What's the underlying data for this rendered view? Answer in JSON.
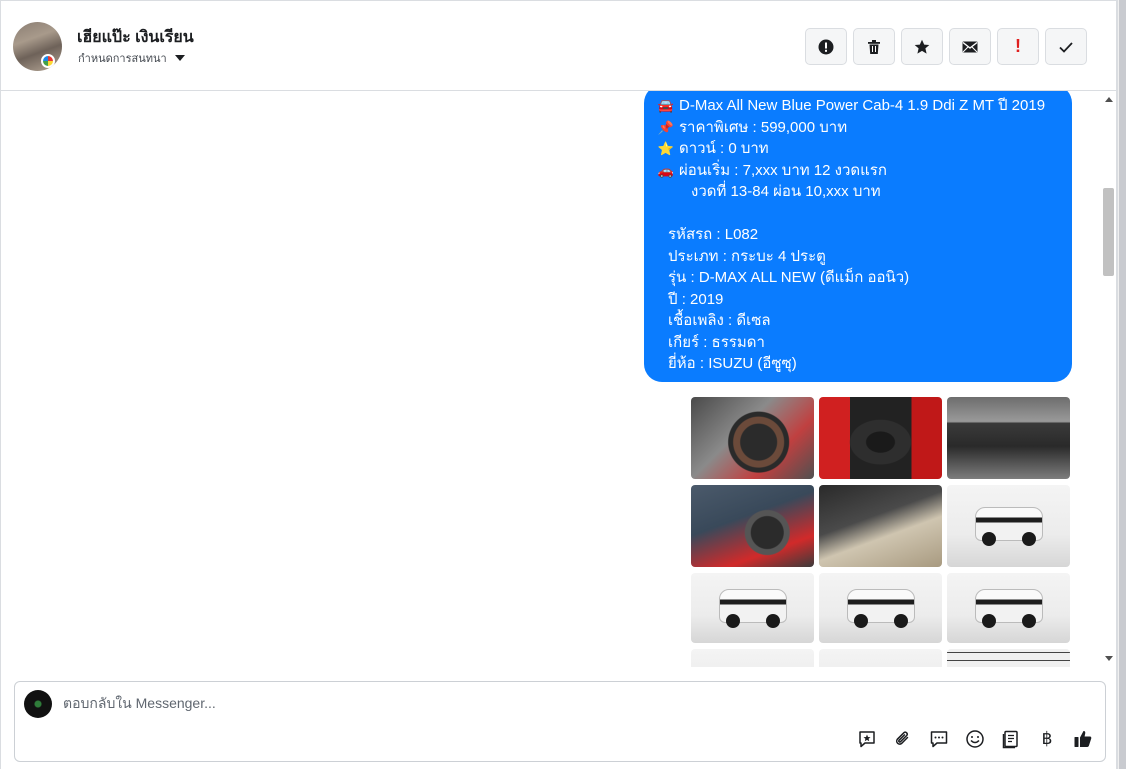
{
  "header": {
    "contact_name": "เฮียแป๊ะ เงินเรียน",
    "assign_label": "กำหนดการสนทนา",
    "actions": [
      {
        "name": "mark-spam-button",
        "icon": "alert-circle-icon"
      },
      {
        "name": "delete-button",
        "icon": "trash-icon"
      },
      {
        "name": "star-button",
        "icon": "star-icon"
      },
      {
        "name": "mark-unread-button",
        "icon": "envelope-icon"
      },
      {
        "name": "follow-up-button",
        "icon": "exclamation-icon",
        "label": "!"
      },
      {
        "name": "mark-done-button",
        "icon": "check-icon"
      }
    ]
  },
  "message": {
    "line1_emoji": "🚘",
    "line1": "D-Max All New Blue Power Cab-4 1.9 Ddi Z MT ปี 2019",
    "line2_emoji": "📌",
    "line2": "ราคาพิเศษ : 599,000 บาท",
    "line3_emoji": "⭐",
    "line3": "ดาวน์ : 0 บาท",
    "line4_emoji": "🚗",
    "line4": "ผ่อนเริ่ม : 7,xxx บาท 12 งวดแรก",
    "line5": "งวดที่ 13-84 ผ่อน 10,xxx บาท",
    "details": [
      "รหัสรถ : L082",
      "ประเภท : กระบะ 4 ประตู",
      "รุ่น : D-MAX ALL NEW (ดีแม็ก ออนิว)",
      "ปี : 2019",
      "เชื้อเพลิง : ดีเซล",
      "เกียร์ : ธรรมดา",
      "ยี่ห้อ : ISUZU (อีซูซุ)"
    ]
  },
  "photos": [
    {
      "name": "photo-steering-wheel",
      "style": "p-wheel1"
    },
    {
      "name": "photo-gear-shift",
      "style": "p-gear"
    },
    {
      "name": "photo-dashboard-console",
      "style": "p-dash"
    },
    {
      "name": "photo-driver-cabin",
      "style": "p-wheel2"
    },
    {
      "name": "photo-door-panel",
      "style": "p-door"
    },
    {
      "name": "photo-truck-front-angle",
      "style": "p-car"
    },
    {
      "name": "photo-truck-front",
      "style": "p-car"
    },
    {
      "name": "photo-truck-side",
      "style": "p-car"
    },
    {
      "name": "photo-truck-rear",
      "style": "p-car"
    },
    {
      "name": "photo-partial-1",
      "style": "p-partial"
    },
    {
      "name": "photo-partial-2",
      "style": "p-partial"
    },
    {
      "name": "photo-partial-3",
      "style": "p-rack"
    }
  ],
  "composer": {
    "placeholder": "ตอบกลับใน Messenger...",
    "tools": [
      "saved-reply-icon",
      "attachment-icon",
      "chat-bubble-icon",
      "emoji-icon",
      "catalog-icon",
      "baht-icon",
      "like-icon"
    ],
    "baht_symbol": "฿"
  },
  "colors": {
    "bubble": "#0a7cff",
    "border": "#dadde1"
  }
}
